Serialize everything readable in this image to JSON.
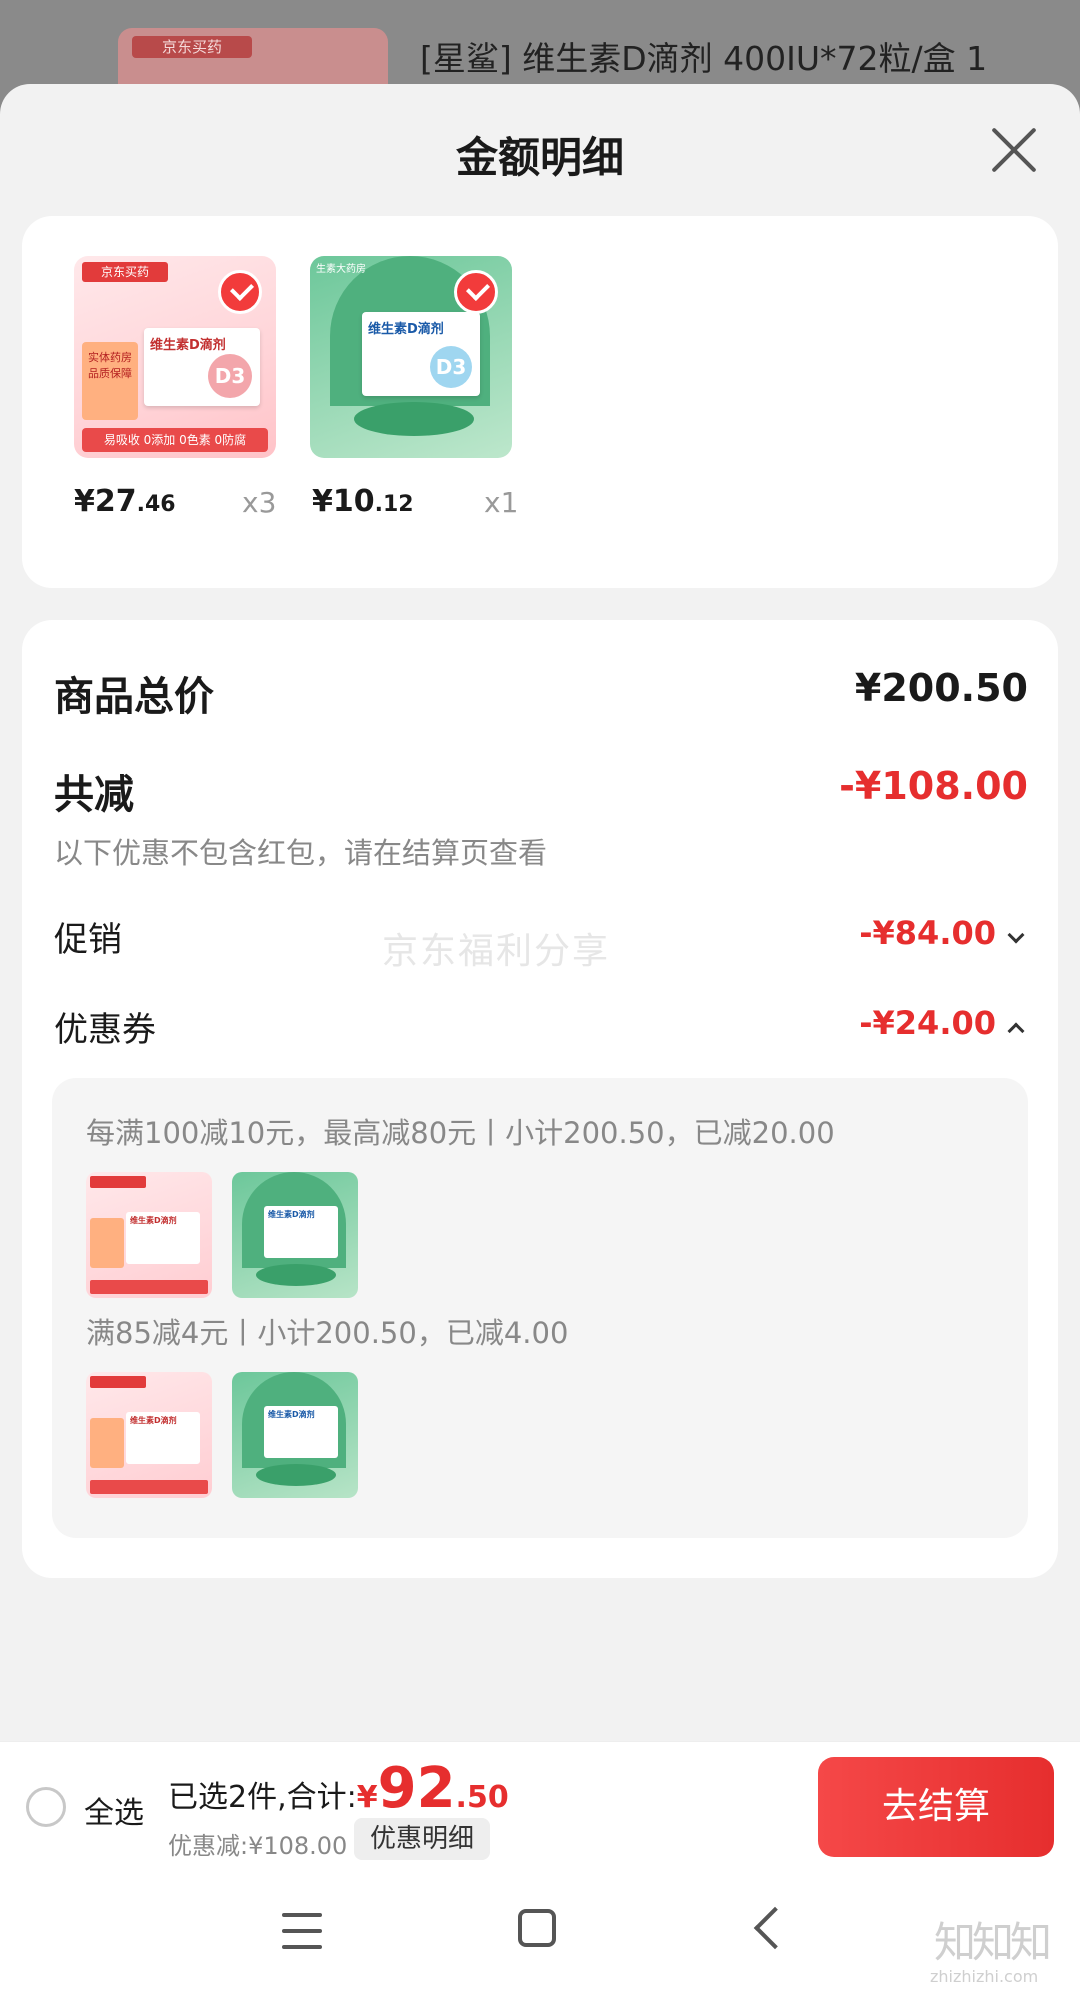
{
  "background": {
    "brand_tag": "京东买药",
    "product_title": "[星鲨] 维生素D滴剂 400IU*72粒/盒 1"
  },
  "sheet": {
    "title": "金额明细"
  },
  "products": [
    {
      "image_brand": "京东买药",
      "box_title": "维生素D滴剂",
      "badge": "D3",
      "side_text": "实体药房 品质保障",
      "tags": "易吸收 0添加 0色素 0防腐",
      "price_int": "¥27",
      "price_dec": ".46",
      "qty": "x3",
      "selected": true
    },
    {
      "image_top": "生素大药房",
      "box_title": "维生素D滴剂",
      "badge": "D3",
      "price_int": "¥10",
      "price_dec": ".12",
      "qty": "x1",
      "selected": true
    }
  ],
  "summary": {
    "total_label": "商品总价",
    "total_value": "¥200.50",
    "reduce_label": "共减",
    "reduce_value": "-¥108.00",
    "hint": "以下优惠不包含红包，请在结算页查看",
    "promo_label": "促销",
    "promo_value": "-¥84.00",
    "coupon_label": "优惠券",
    "coupon_value": "-¥24.00",
    "watermark": "京东福利分享"
  },
  "coupons": [
    {
      "rule": "每满100减10元，最高减80元丨小计200.50，已减20.00"
    },
    {
      "rule": "满85减4元丨小计200.50，已减4.00"
    }
  ],
  "bottom_bar": {
    "select_all": "全选",
    "selected_text": "已选2件,合计:",
    "currency": "¥",
    "total_int": "92",
    "total_dec": ".50",
    "discount_text": "优惠减:¥108.00",
    "detail_button": "优惠明细",
    "checkout_button": "去结算"
  },
  "corner": {
    "logo": "知知知",
    "url": "zhizhizhi.com"
  },
  "colors": {
    "accent_red": "#e62e2e",
    "checkout_gradient_start": "#f54848"
  }
}
